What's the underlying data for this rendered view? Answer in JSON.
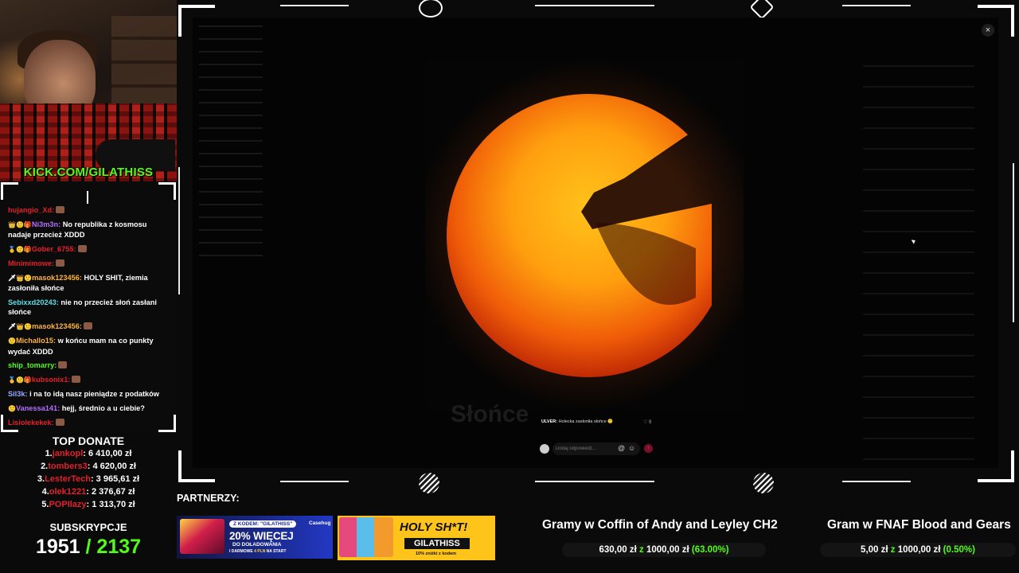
{
  "webcam": {
    "channel_url": "KICK.COM/GILATHISS"
  },
  "chat": {
    "messages": [
      {
        "user": "hujangio_Xd:",
        "user_color": "#e3202a",
        "text": "",
        "badges": "",
        "emote": true
      },
      {
        "user": "Ni3m3n:",
        "user_color": "#b56cff",
        "text": "No republika z kosmosu nadaje przecież XDDD",
        "badges": "👑🙂🎁",
        "emote": false
      },
      {
        "user": "Gober_6755:",
        "user_color": "#e3202a",
        "text": "",
        "badges": "🥇🙂🎁",
        "emote": true
      },
      {
        "user": "Minimimowe:",
        "user_color": "#e3202a",
        "text": "",
        "badges": "",
        "emote": true
      },
      {
        "user": "masok123456:",
        "user_color": "#ffb43b",
        "text": "HOLY SHIT, ziemia zasłoniła słońce",
        "badges": "🗡👑🙂",
        "emote": false
      },
      {
        "user": "Sebixxd20243:",
        "user_color": "#5ce0e6",
        "text": "nie no przecież słoń zasłani słońce",
        "badges": "",
        "emote": false
      },
      {
        "user": "masok123456:",
        "user_color": "#ffb43b",
        "text": "",
        "badges": "🗡👑🙂",
        "emote": true
      },
      {
        "user": "Michallo15:",
        "user_color": "#ffb43b",
        "text": "w końcu mam na co punkty wydać XDDD",
        "badges": "🙂",
        "emote": false
      },
      {
        "user": "ship_tomarry:",
        "user_color": "#53fc18",
        "text": "",
        "badges": "",
        "emote": true
      },
      {
        "user": "kubsonix1:",
        "user_color": "#e3202a",
        "text": "",
        "badges": "🥇🙂🎁",
        "emote": true
      },
      {
        "user": "Sil3k:",
        "user_color": "#9aa8ff",
        "text": "i na to idą nasz pieniądze z podatków",
        "badges": "",
        "emote": false
      },
      {
        "user": "Vanessa141:",
        "user_color": "#b56cff",
        "text": "hejj, średnio a u ciebie?",
        "badges": "🙂",
        "emote": false
      },
      {
        "user": "Lisiolekekek:",
        "user_color": "#e3202a",
        "text": "",
        "badges": "",
        "emote": true
      }
    ]
  },
  "top_donate": {
    "title": "TOP DONATE",
    "rows": [
      {
        "rank": "1.",
        "name": "jankopl",
        "amount": ": 6 410,00 zł"
      },
      {
        "rank": "2.",
        "name": "tombers3",
        "amount": ": 4 620,00 zł"
      },
      {
        "rank": "3.",
        "name": "LesterTech",
        "amount": ": 3 965,61 zł"
      },
      {
        "rank": "4.",
        "name": "olek1221",
        "amount": ": 2 376,67 zł"
      },
      {
        "rank": "5.",
        "name": "POPIlazy",
        "amount": ": 1 313,70 zł"
      }
    ]
  },
  "subs": {
    "title": "SUBSKRYPCJE",
    "current": "1951",
    "goal": "/ 2137"
  },
  "screen": {
    "close_label": "×",
    "ghost_title": "Słońce",
    "post_user": "ULVER:",
    "post_text": "Holecka zasłoniła słońce 🙂",
    "post_likes": "♡ 9",
    "reply_placeholder": "Dodaj odpowiedź...",
    "reply_at": "@",
    "reply_emoji": "☺",
    "reply_send": "↑"
  },
  "partners": {
    "label": "PARTNERZY:",
    "casehug": {
      "code": "Z KODEM: \"GILATHISS\"",
      "logo": "Casehug",
      "headline": "20% WIĘCEJ",
      "sub1": "DO DOŁADOWANIA",
      "sub2_prefix": "I DARMOWE ",
      "sub2_highlight": "4 PLN",
      "sub2_suffix": " NA START"
    },
    "holy": {
      "headline": "HOLY SH*T!",
      "code": "GILATHISS",
      "discount": "10% zniżki z kodem"
    }
  },
  "goals": [
    {
      "title": "Gramy w Coffin of Andy and Leyley CH2",
      "current": "630,00 zł",
      "sep": "z",
      "target": "1000,00 zł",
      "pct": "(63.00%)",
      "progress": 0.63
    },
    {
      "title": "Gram w FNAF Blood and Gears",
      "current": "5,00 zł",
      "sep": "z",
      "target": "1000,00 zł",
      "pct": "(0.50%)",
      "progress": 0.005
    }
  ],
  "colors": {
    "kick_green": "#53fc18",
    "donor_red": "#e3202a",
    "background": "#0a0a0b"
  },
  "icons": [
    "kick-logo-icon",
    "crosshair-logo-icon",
    "close-icon",
    "mention-icon",
    "emoji-icon",
    "send-icon"
  ]
}
